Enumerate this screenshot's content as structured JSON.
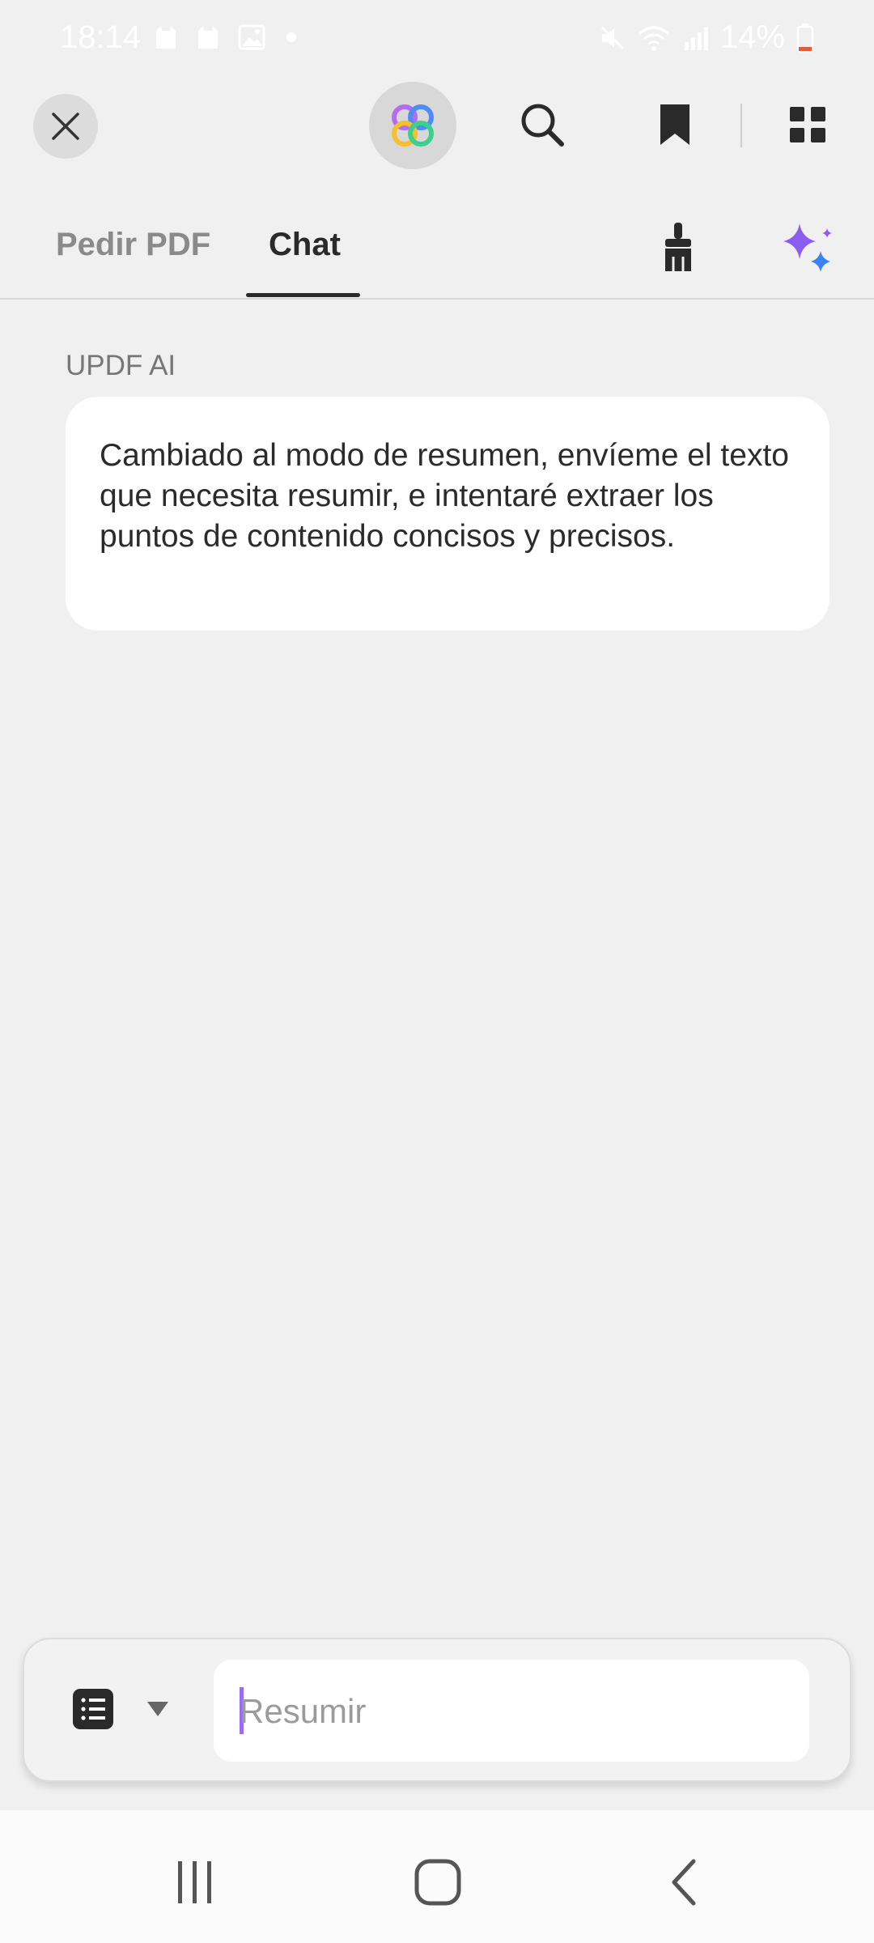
{
  "status_bar": {
    "time": "18:14",
    "battery": "14%",
    "icons": [
      "cat-notification-icon",
      "cat-notification-icon",
      "gallery-icon",
      "dot-icon",
      "mute-icon",
      "wifi-icon",
      "signal-icon",
      "battery-icon"
    ]
  },
  "toolbar": {
    "icons": [
      "close-icon",
      "updf-ai-logo-icon",
      "search-icon",
      "bookmark-icon",
      "grid-icon"
    ]
  },
  "tabs": [
    {
      "label": "Pedir PDF",
      "active": false
    },
    {
      "label": "Chat",
      "active": true
    }
  ],
  "tab_actions": {
    "icons": [
      "broom-icon",
      "sparkle-icon"
    ]
  },
  "chat": {
    "messages": [
      {
        "sender": "UPDF AI",
        "text": "Cambiado al modo de resumen, envíeme el texto que necesita resumir, e intentaré extraer los puntos de contenido concisos y precisos."
      }
    ]
  },
  "composer": {
    "mode_icon": "list-icon",
    "placeholder": "Resumir",
    "value": ""
  },
  "nav_bar": {
    "icons": [
      "recents-icon",
      "home-icon",
      "back-icon"
    ]
  },
  "colors": {
    "background": "#f0f0f0",
    "accent": "#8a5cf0",
    "sparkle_purple": "#8a5cf0",
    "sparkle_blue": "#3b82f6"
  }
}
